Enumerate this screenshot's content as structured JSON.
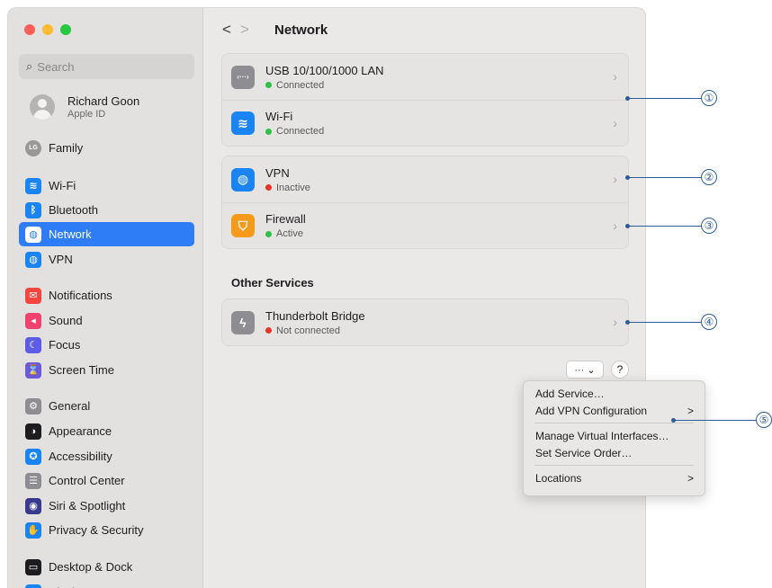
{
  "sidebar": {
    "search_placeholder": "Search",
    "account_name": "Richard Goon",
    "account_sub": "Apple ID",
    "family_label": "Family",
    "family_badge": "LG",
    "items": [
      {
        "label": "Wi-Fi",
        "icon": "wifi-icon",
        "color": "#1a84f5",
        "glyph": "≋"
      },
      {
        "label": "Bluetooth",
        "icon": "bluetooth-icon",
        "color": "#1a84f5",
        "glyph": "ᛒ"
      },
      {
        "label": "Network",
        "icon": "globe-icon",
        "color": "#ffffff",
        "glyph": "◍"
      },
      {
        "label": "VPN",
        "icon": "vpn-globe-icon",
        "color": "#1a84f5",
        "glyph": "◍"
      },
      {
        "label": "Notifications",
        "icon": "bell-icon",
        "color": "#f5453d",
        "glyph": "✉"
      },
      {
        "label": "Sound",
        "icon": "speaker-icon",
        "color": "#f0426e",
        "glyph": "◂"
      },
      {
        "label": "Focus",
        "icon": "moon-icon",
        "color": "#5d5ce6",
        "glyph": "☾"
      },
      {
        "label": "Screen Time",
        "icon": "hourglass-icon",
        "color": "#6a5ad9",
        "glyph": "⌛"
      },
      {
        "label": "General",
        "icon": "gear-icon",
        "color": "#8e8e92",
        "glyph": "⚙"
      },
      {
        "label": "Appearance",
        "icon": "appearance-icon",
        "color": "#1d1d1f",
        "glyph": "◑"
      },
      {
        "label": "Accessibility",
        "icon": "accessibility-icon",
        "color": "#1a84f5",
        "glyph": "✪"
      },
      {
        "label": "Control Center",
        "icon": "control-center-icon",
        "color": "#8e8e92",
        "glyph": "☰"
      },
      {
        "label": "Siri & Spotlight",
        "icon": "siri-icon",
        "color": "#3a3a8c",
        "glyph": "◉"
      },
      {
        "label": "Privacy & Security",
        "icon": "hand-icon",
        "color": "#1a84f5",
        "glyph": "✋"
      },
      {
        "label": "Desktop & Dock",
        "icon": "dock-icon",
        "color": "#1d1d1f",
        "glyph": "▭"
      },
      {
        "label": "Displays",
        "icon": "sun-icon",
        "color": "#1a84f5",
        "glyph": "☀"
      }
    ]
  },
  "header": {
    "back": "<",
    "forward": ">",
    "title": "Network"
  },
  "groups": [
    {
      "rows": [
        {
          "title": "USB 10/100/1000 LAN",
          "status": "Connected",
          "status_color": "#30c048",
          "icon": "ethernet-icon",
          "icon_color": "#8e8e92",
          "glyph": "‹···›"
        },
        {
          "title": "Wi-Fi",
          "status": "Connected",
          "status_color": "#30c048",
          "icon": "wifi-icon",
          "icon_color": "#1a84f5",
          "glyph": "≋"
        }
      ]
    },
    {
      "rows": [
        {
          "title": "VPN",
          "status": "Inactive",
          "status_color": "#e8342b",
          "icon": "vpn-globe-icon",
          "icon_color": "#1a84f5",
          "glyph": "◍"
        },
        {
          "title": "Firewall",
          "status": "Active",
          "status_color": "#30c048",
          "icon": "firewall-icon",
          "icon_color": "#f59a1b",
          "glyph": "⛉"
        }
      ]
    },
    {
      "rows": [
        {
          "title": "Thunderbolt Bridge",
          "status": "Not connected",
          "status_color": "#e8342b",
          "icon": "thunderbolt-icon",
          "icon_color": "#8e8e92",
          "glyph": "ϟ"
        }
      ]
    }
  ],
  "other_services_label": "Other Services",
  "buttons": {
    "more_label": "··· ⌄",
    "help_label": "?"
  },
  "menu": {
    "items": [
      {
        "label": "Add Service…",
        "submenu": false
      },
      {
        "label": "Add VPN Configuration",
        "submenu": true
      },
      {
        "label": "Manage Virtual Interfaces…",
        "submenu": false
      },
      {
        "label": "Set Service Order…",
        "submenu": false
      },
      {
        "label": "Locations",
        "submenu": true
      }
    ],
    "submenu_glyph": ">"
  },
  "callouts": [
    "①",
    "②",
    "③",
    "④",
    "⑤"
  ]
}
